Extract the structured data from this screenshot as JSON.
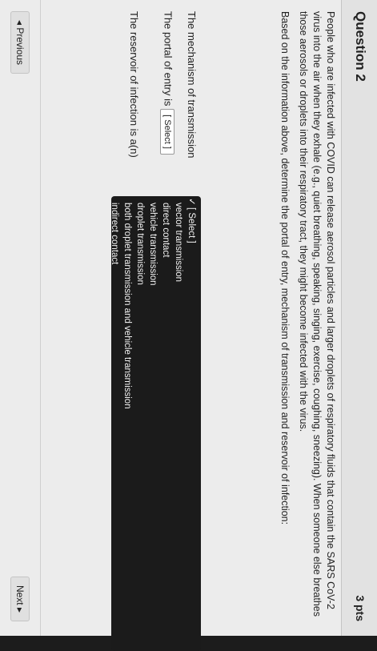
{
  "question": {
    "title": "Question 2",
    "points": "3 pts",
    "paragraph1": "People who are infected with COVID can release aerosol particles and larger droplets of respiratory fluids that contain the SARS CoV-2 virus into the air when they exhale (e.g., quiet breathing, speaking, singing, exercise, coughing, sneezing). When someone else breathes those aerosols or droplets into their respiratory tract, they might become infected with the virus.",
    "paragraph2": "Based on the information above, determine the portal of entry, mechanism of transmission and reservoir of infection:"
  },
  "blanks": {
    "mechanism_label": "The mechanism of transmission",
    "portal_label": "The portal of entry is",
    "portal_select": "[ Select ]",
    "reservoir_label": "The reservoir of infection is a(n)"
  },
  "dropdown": {
    "options": [
      "[ Select ]",
      "vector transmission",
      "direct contact",
      "vehicle transmission",
      "droplet transmission",
      "both droplet transmission and vehicle transmission",
      "indirect contact"
    ]
  },
  "nav": {
    "previous": "◂ Previous",
    "next": "Next ▸"
  }
}
